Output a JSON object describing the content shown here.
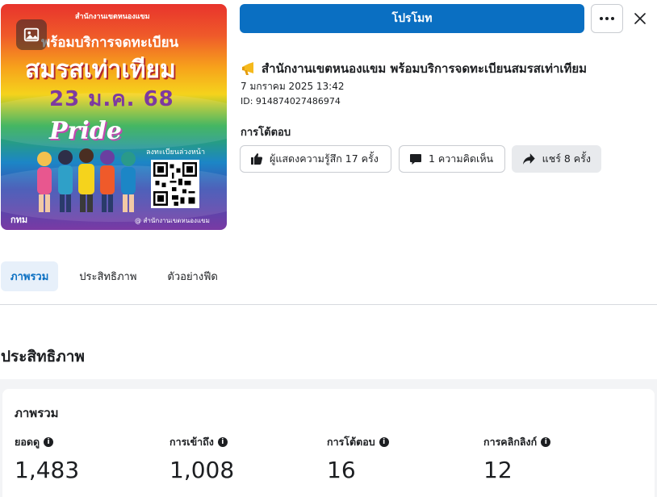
{
  "thumbnail": {
    "org_top": "สำนักงานเขตหนองแขม",
    "line1": "พร้อมบริการจดทะเบียน",
    "line2": "สมรสเท่าเทียม",
    "line3": "23 ม.ค. 68",
    "pride": "Pride",
    "scan_label": "ลงทะเบียนล่วงหน้า",
    "bkk_logo": "กทม",
    "page_name": "@ สำนักงานเขตหนองแขม",
    "media_icon": "image-icon"
  },
  "actions": {
    "promote_label": "โปรโมท",
    "more_icon": "more-icon",
    "close_icon": "close-icon"
  },
  "post": {
    "emoji_icon": "megaphone-icon",
    "title": "สำนักงานเขตหนองแขม พร้อมบริการจดทะเบียนสมรสเท่าเทียม",
    "date": "7 มกราคม 2025 13:42",
    "id": "ID: 914874027486974"
  },
  "interactions": {
    "heading": "การโต้ตอบ",
    "reactions_label": "ผู้แสดงความรู้สึก 17 ครั้ง",
    "comments_label": "1 ความคิดเห็น",
    "shares_label": "แชร์ 8 ครั้ง"
  },
  "tabs": [
    {
      "label": "ภาพรวม",
      "active": true
    },
    {
      "label": "ประสิทธิภาพ",
      "active": false
    },
    {
      "label": "ตัวอย่างฟีด",
      "active": false
    }
  ],
  "performance": {
    "heading": "ประสิทธิภาพ",
    "overview_title": "ภาพรวม",
    "metrics": [
      {
        "label": "ยอดดู",
        "value": "1,483"
      },
      {
        "label": "การเข้าถึง",
        "value": "1,008"
      },
      {
        "label": "การโต้ตอบ",
        "value": "16"
      },
      {
        "label": "การคลิกลิงก์",
        "value": "12"
      }
    ]
  },
  "colors": {
    "primary": "#0a6fc2",
    "tab_active_bg": "#e7f0fa",
    "chip_filled_bg": "#e8eaed",
    "text": "#1c1e21"
  }
}
